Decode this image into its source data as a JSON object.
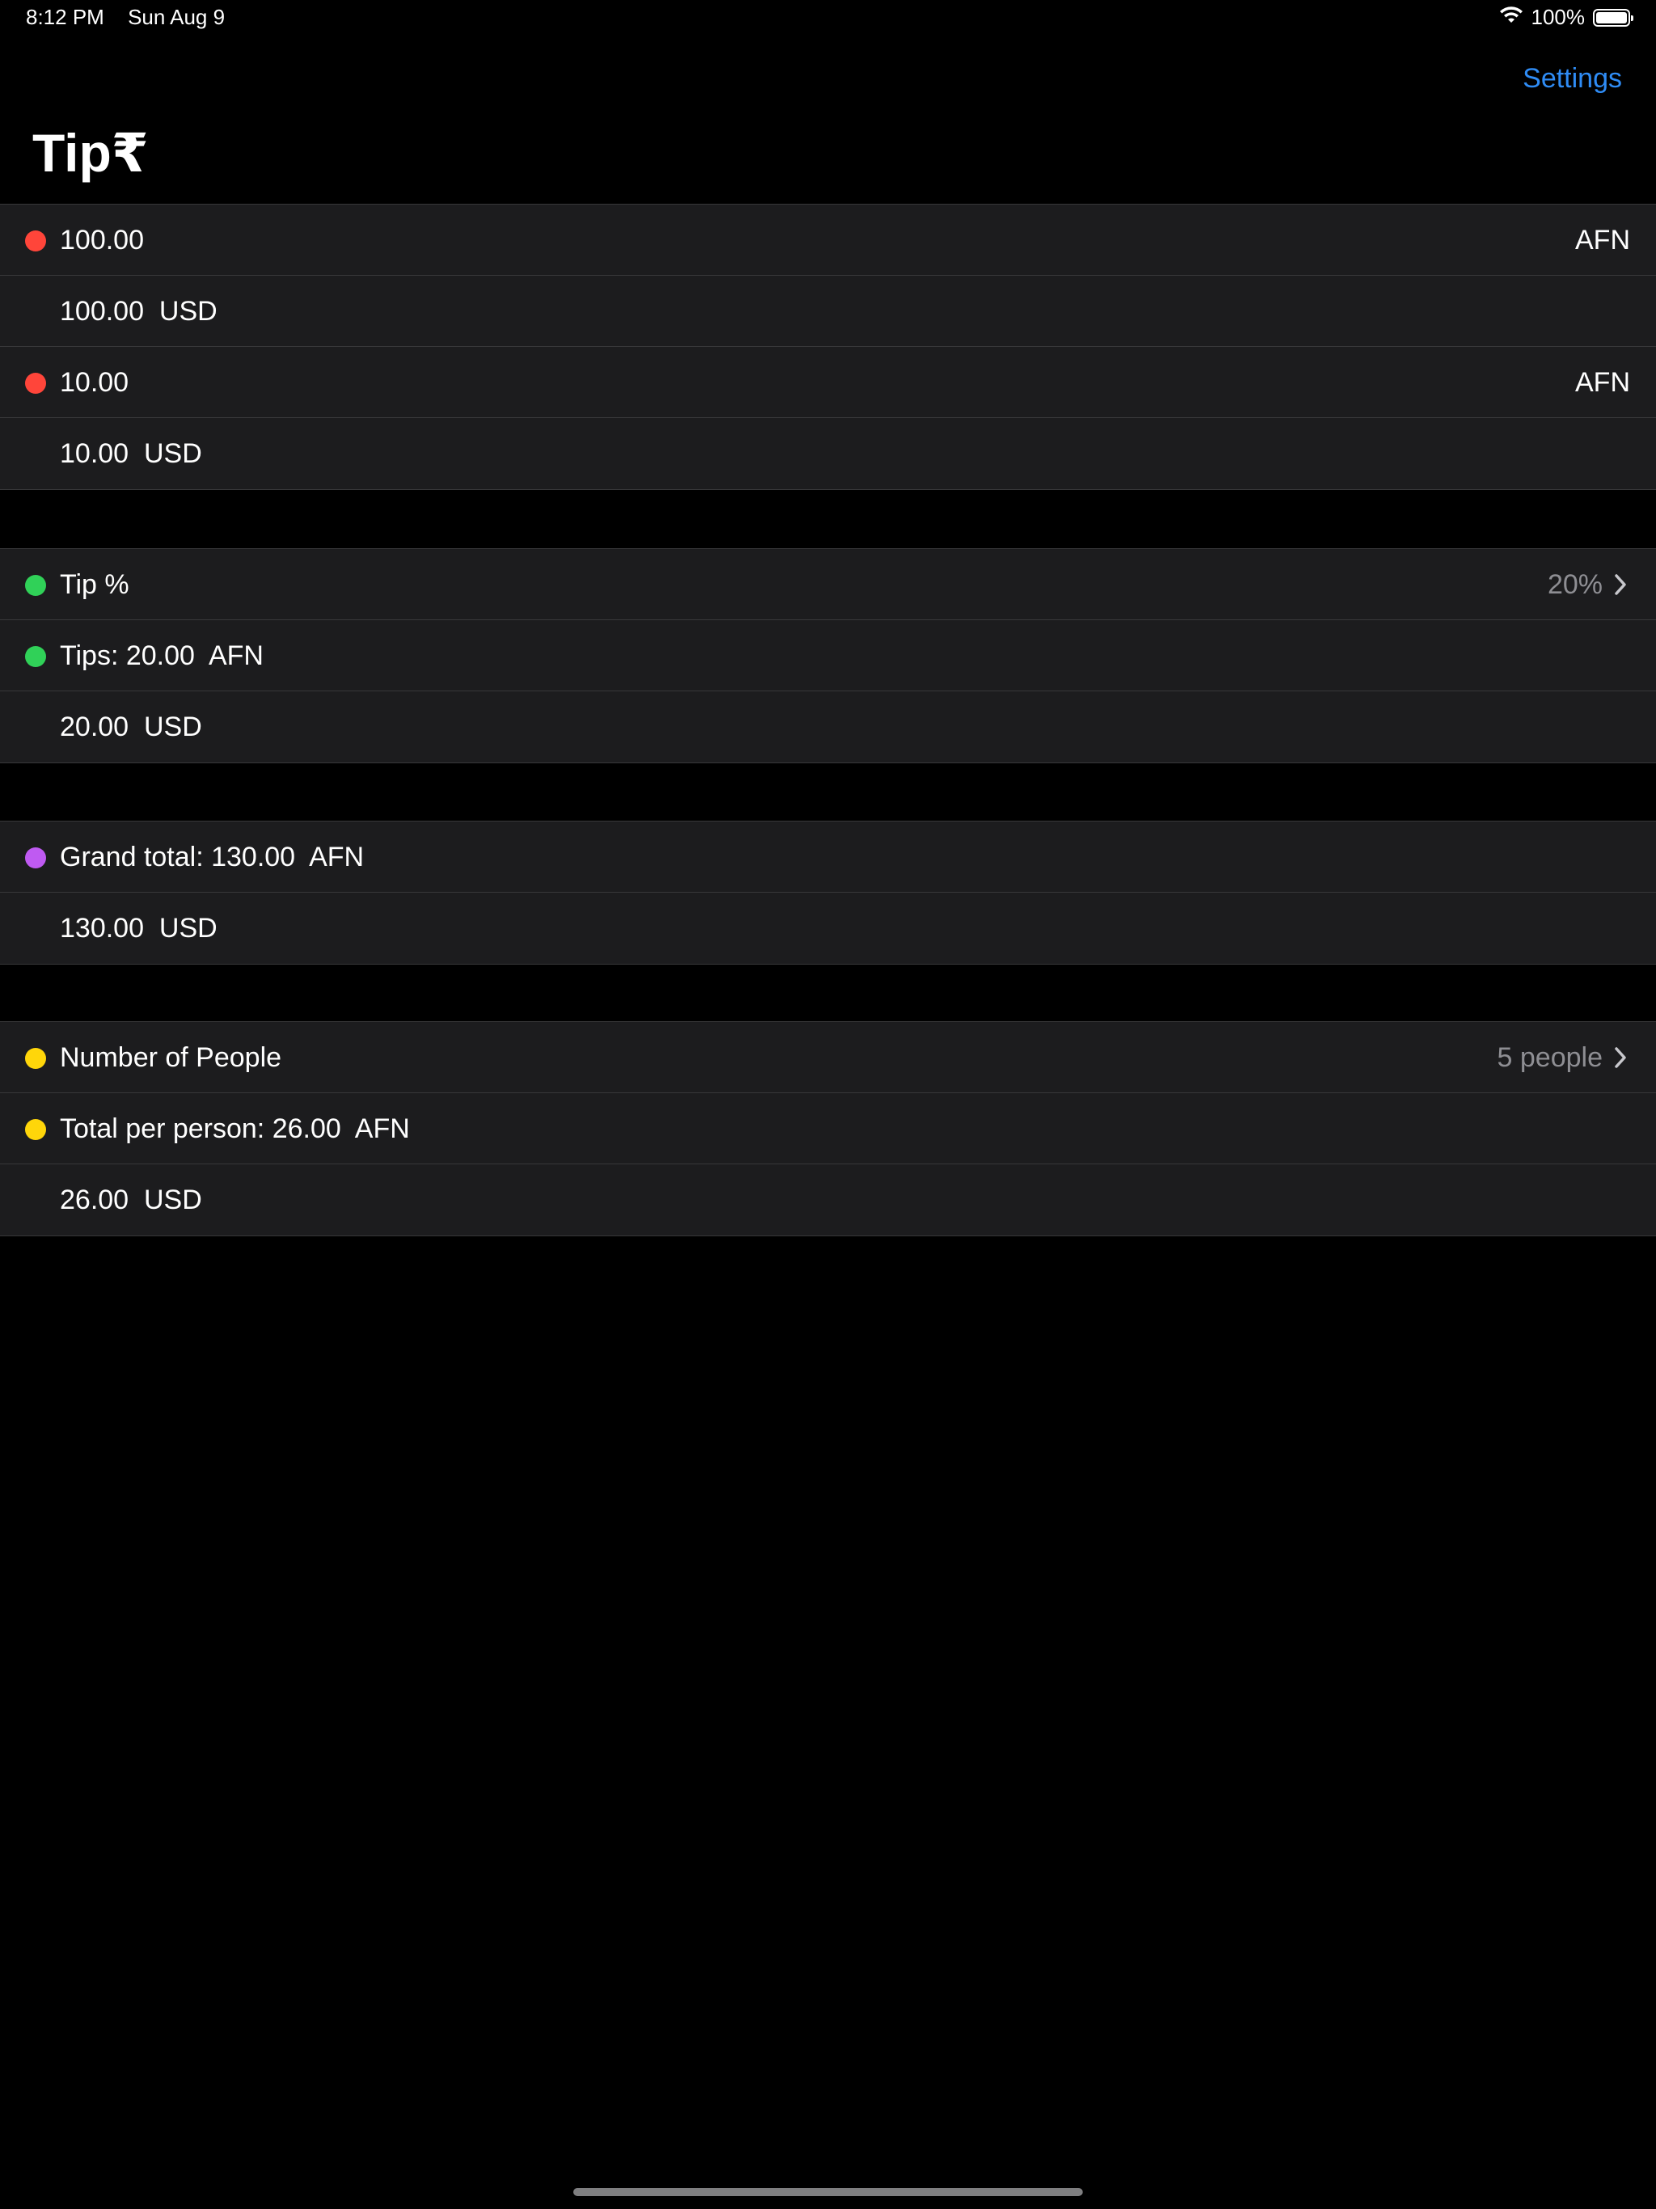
{
  "status": {
    "time": "8:12 PM",
    "date": "Sun Aug 9",
    "battery": "100%"
  },
  "nav": {
    "settings": "Settings",
    "title": "Tip₹"
  },
  "colors": {
    "red": "#ff453a",
    "green": "#30d158",
    "purple": "#bf5af2",
    "yellow": "#ffd60a",
    "accent": "#2f8cf5"
  },
  "bill": {
    "amount": "100.00",
    "amount_currency": "AFN",
    "amount_converted": "100.00  USD",
    "tax": "10.00",
    "tax_currency": "AFN",
    "tax_converted": "10.00  USD"
  },
  "tip": {
    "label": "Tip %",
    "value": "20%",
    "tips": "Tips: 20.00  AFN",
    "tips_converted": "20.00  USD"
  },
  "grand": {
    "total": "Grand total: 130.00  AFN",
    "total_converted": "130.00  USD"
  },
  "people": {
    "label": "Number of People",
    "value": "5 people",
    "per_person": "Total per person: 26.00  AFN",
    "per_person_converted": "26.00  USD"
  }
}
